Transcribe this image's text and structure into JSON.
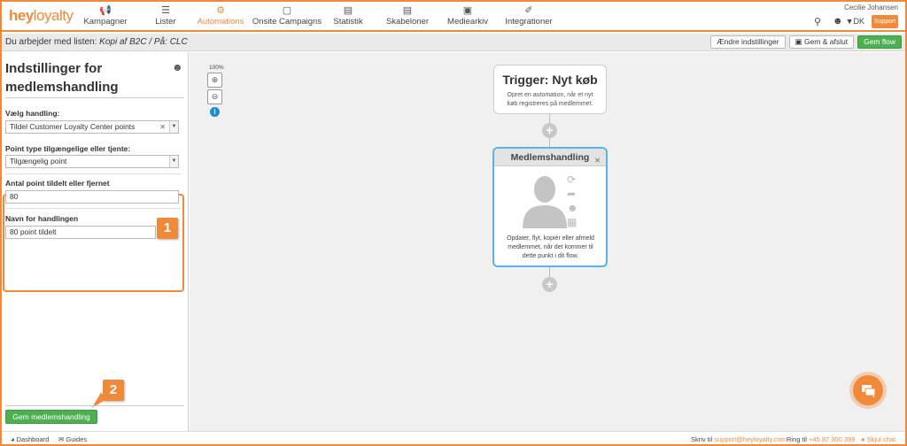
{
  "brand": {
    "logo_hey": "hey",
    "logo_loyalty": "loyalty",
    "accent": "#f08a3a"
  },
  "nav": {
    "items": [
      {
        "label": "Kampagner",
        "icon": "megaphone-icon",
        "glyph": "📢"
      },
      {
        "label": "Lister",
        "icon": "list-icon",
        "glyph": "☰"
      },
      {
        "label": "Automations",
        "icon": "automation-icon",
        "glyph": "⚙",
        "active": true
      },
      {
        "label": "Onsite Campaigns",
        "icon": "window-icon",
        "glyph": "▢"
      },
      {
        "label": "Statistik",
        "icon": "chart-icon",
        "glyph": "📊"
      },
      {
        "label": "Skabeloner",
        "icon": "template-icon",
        "glyph": "▤"
      },
      {
        "label": "Mediearkiv",
        "icon": "image-icon",
        "glyph": "🖼"
      },
      {
        "label": "Integrationer",
        "icon": "plug-icon",
        "glyph": "✎"
      }
    ],
    "user_name": "Cecilie Johansen",
    "lang": "DK",
    "support": "Support"
  },
  "subheader": {
    "prefix": "Du arbejder med listen:",
    "list_name": "Kopi af B2C",
    "on": "/ På:",
    "site": "CLC",
    "buttons": {
      "change": "Ændre indstillinger",
      "save_exit": "Gem & afslut",
      "save_flow": "Gem flow"
    }
  },
  "panel": {
    "title": "Indstillinger for medlemshandling",
    "select_action_label": "Vælg handling:",
    "select_action_value": "Tildel Customer Loyalty Center points",
    "point_type_label": "Point type tilgængelige eller tjente:",
    "point_type_value": "Tilgængelig point",
    "points_label": "Antal point tildelt eller fjernet",
    "points_value": "80",
    "name_label": "Navn for handlingen",
    "name_value": "80 point tildelt",
    "save_button": "Gem medlemshandling",
    "callout_1": "1",
    "callout_2": "2"
  },
  "canvas": {
    "zoom_level": "100%",
    "trigger_title": "Trigger: Nyt køb",
    "trigger_desc": "Opret en automation, når et nyt køb registreres på medlemmet.",
    "member_title": "Medlemshandling",
    "member_desc": "Opdater, flyt, kopiér eller afmeld medlemmet, når det kommer til dette punkt i dit flow."
  },
  "footer": {
    "dashboard": "Dashboard",
    "guides": "Guides",
    "write_to": "Skriv til",
    "email": "support@heyloyalty.com",
    "call": "Ring til",
    "phone": "+45 87 300 399",
    "hide_chat": "Skjul chat"
  }
}
